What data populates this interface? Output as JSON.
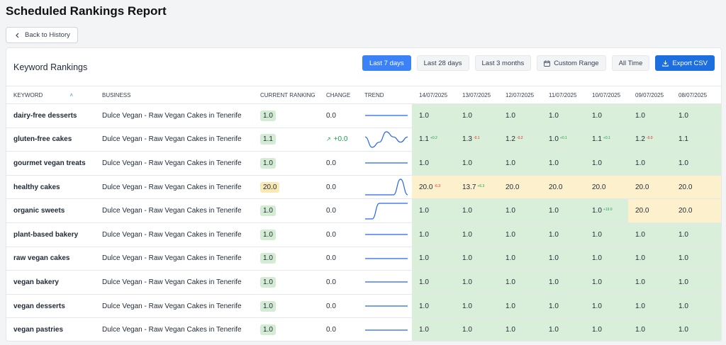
{
  "page": {
    "title": "Scheduled Rankings Report",
    "back_label": "Back to History"
  },
  "card": {
    "title": "Keyword Rankings"
  },
  "toolbar": {
    "buttons": [
      "Last 7 days",
      "Last 28 days",
      "Last 3 months",
      "Custom Range",
      "All Time"
    ],
    "active": "Last 7 days",
    "export_label": "Export CSV"
  },
  "columns": {
    "keyword": "KEYWORD",
    "business": "BUSINESS",
    "current": "CURRENT RANKING",
    "change": "CHANGE",
    "trend": "TREND",
    "dates": [
      "14/07/2025",
      "13/07/2025",
      "12/07/2025",
      "11/07/2025",
      "10/07/2025",
      "09/07/2025",
      "08/07/2025"
    ]
  },
  "colors": {
    "good": "#d9efd9",
    "warn": "#fdf1cd",
    "accent": "#3b82f6",
    "spark": "#2563eb"
  },
  "rows": [
    {
      "keyword": "dairy-free desserts",
      "business": "Dulce Vegan - Raw Vegan Cakes in Tenerife",
      "current": "1.0",
      "current_status": "good",
      "change": "0.0",
      "change_dir": "none",
      "trend": [
        1,
        1,
        1,
        1,
        1,
        1,
        1
      ],
      "cells": [
        {
          "v": "1.0",
          "s": "good"
        },
        {
          "v": "1.0",
          "s": "good"
        },
        {
          "v": "1.0",
          "s": "good"
        },
        {
          "v": "1.0",
          "s": "good"
        },
        {
          "v": "1.0",
          "s": "good"
        },
        {
          "v": "1.0",
          "s": "good"
        },
        {
          "v": "1.0",
          "s": "good"
        }
      ]
    },
    {
      "keyword": "gluten-free cakes",
      "business": "Dulce Vegan - Raw Vegan Cakes in Tenerife",
      "current": "1.1",
      "current_status": "good",
      "change": "+0.0",
      "change_dir": "up",
      "trend": [
        1.1,
        1.3,
        1.2,
        1.0,
        1.1,
        1.2,
        1.1
      ],
      "cells": [
        {
          "v": "1.1",
          "s": "good",
          "d": "+0.2",
          "dir": "up"
        },
        {
          "v": "1.3",
          "s": "good",
          "d": "-0.1",
          "dir": "down"
        },
        {
          "v": "1.2",
          "s": "good",
          "d": "-0.2",
          "dir": "down"
        },
        {
          "v": "1.0",
          "s": "good",
          "d": "+0.1",
          "dir": "up"
        },
        {
          "v": "1.1",
          "s": "good",
          "d": "+0.1",
          "dir": "up"
        },
        {
          "v": "1.2",
          "s": "good",
          "d": "-0.0",
          "dir": "down"
        },
        {
          "v": "1.1",
          "s": "good"
        }
      ]
    },
    {
      "keyword": "gourmet vegan treats",
      "business": "Dulce Vegan - Raw Vegan Cakes in Tenerife",
      "current": "1.0",
      "current_status": "good",
      "change": "0.0",
      "change_dir": "none",
      "trend": [
        1,
        1,
        1,
        1,
        1,
        1,
        1
      ],
      "cells": [
        {
          "v": "1.0",
          "s": "good"
        },
        {
          "v": "1.0",
          "s": "good"
        },
        {
          "v": "1.0",
          "s": "good"
        },
        {
          "v": "1.0",
          "s": "good"
        },
        {
          "v": "1.0",
          "s": "good"
        },
        {
          "v": "1.0",
          "s": "good"
        },
        {
          "v": "1.0",
          "s": "good"
        }
      ]
    },
    {
      "keyword": "healthy cakes",
      "business": "Dulce Vegan - Raw Vegan Cakes in Tenerife",
      "current": "20.0",
      "current_status": "warn",
      "change": "0.0",
      "change_dir": "none",
      "trend": [
        20,
        20,
        20,
        20,
        20,
        13.7,
        20
      ],
      "cells": [
        {
          "v": "20.0",
          "s": "warn",
          "d": "-6.3",
          "dir": "down"
        },
        {
          "v": "13.7",
          "s": "warn",
          "d": "+6.3",
          "dir": "up"
        },
        {
          "v": "20.0",
          "s": "warn"
        },
        {
          "v": "20.0",
          "s": "warn"
        },
        {
          "v": "20.0",
          "s": "warn"
        },
        {
          "v": "20.0",
          "s": "warn"
        },
        {
          "v": "20.0",
          "s": "warn"
        }
      ]
    },
    {
      "keyword": "organic sweets",
      "business": "Dulce Vegan - Raw Vegan Cakes in Tenerife",
      "current": "1.0",
      "current_status": "good",
      "change": "0.0",
      "change_dir": "none",
      "trend": [
        20,
        20,
        1,
        1,
        1,
        1,
        1
      ],
      "cells": [
        {
          "v": "1.0",
          "s": "good"
        },
        {
          "v": "1.0",
          "s": "good"
        },
        {
          "v": "1.0",
          "s": "good"
        },
        {
          "v": "1.0",
          "s": "good"
        },
        {
          "v": "1.0",
          "s": "good",
          "d": "+19.0",
          "dir": "up"
        },
        {
          "v": "20.0",
          "s": "warn"
        },
        {
          "v": "20.0",
          "s": "warn"
        }
      ]
    },
    {
      "keyword": "plant-based bakery",
      "business": "Dulce Vegan - Raw Vegan Cakes in Tenerife",
      "current": "1.0",
      "current_status": "good",
      "change": "0.0",
      "change_dir": "none",
      "trend": [
        1,
        1,
        1,
        1,
        1,
        1,
        1
      ],
      "cells": [
        {
          "v": "1.0",
          "s": "good"
        },
        {
          "v": "1.0",
          "s": "good"
        },
        {
          "v": "1.0",
          "s": "good"
        },
        {
          "v": "1.0",
          "s": "good"
        },
        {
          "v": "1.0",
          "s": "good"
        },
        {
          "v": "1.0",
          "s": "good"
        },
        {
          "v": "1.0",
          "s": "good"
        }
      ]
    },
    {
      "keyword": "raw vegan cakes",
      "business": "Dulce Vegan - Raw Vegan Cakes in Tenerife",
      "current": "1.0",
      "current_status": "good",
      "change": "0.0",
      "change_dir": "none",
      "trend": [
        1,
        1,
        1,
        1,
        1,
        1,
        1
      ],
      "cells": [
        {
          "v": "1.0",
          "s": "good"
        },
        {
          "v": "1.0",
          "s": "good"
        },
        {
          "v": "1.0",
          "s": "good"
        },
        {
          "v": "1.0",
          "s": "good"
        },
        {
          "v": "1.0",
          "s": "good"
        },
        {
          "v": "1.0",
          "s": "good"
        },
        {
          "v": "1.0",
          "s": "good"
        }
      ]
    },
    {
      "keyword": "vegan bakery",
      "business": "Dulce Vegan - Raw Vegan Cakes in Tenerife",
      "current": "1.0",
      "current_status": "good",
      "change": "0.0",
      "change_dir": "none",
      "trend": [
        1,
        1,
        1,
        1,
        1,
        1,
        1
      ],
      "cells": [
        {
          "v": "1.0",
          "s": "good"
        },
        {
          "v": "1.0",
          "s": "good"
        },
        {
          "v": "1.0",
          "s": "good"
        },
        {
          "v": "1.0",
          "s": "good"
        },
        {
          "v": "1.0",
          "s": "good"
        },
        {
          "v": "1.0",
          "s": "good"
        },
        {
          "v": "1.0",
          "s": "good"
        }
      ]
    },
    {
      "keyword": "vegan desserts",
      "business": "Dulce Vegan - Raw Vegan Cakes in Tenerife",
      "current": "1.0",
      "current_status": "good",
      "change": "0.0",
      "change_dir": "none",
      "trend": [
        1,
        1,
        1,
        1,
        1,
        1,
        1
      ],
      "cells": [
        {
          "v": "1.0",
          "s": "good"
        },
        {
          "v": "1.0",
          "s": "good"
        },
        {
          "v": "1.0",
          "s": "good"
        },
        {
          "v": "1.0",
          "s": "good"
        },
        {
          "v": "1.0",
          "s": "good"
        },
        {
          "v": "1.0",
          "s": "good"
        },
        {
          "v": "1.0",
          "s": "good"
        }
      ]
    },
    {
      "keyword": "vegan pastries",
      "business": "Dulce Vegan - Raw Vegan Cakes in Tenerife",
      "current": "1.0",
      "current_status": "good",
      "change": "0.0",
      "change_dir": "none",
      "trend": [
        1,
        1,
        1,
        1,
        1,
        1,
        1
      ],
      "cells": [
        {
          "v": "1.0",
          "s": "good"
        },
        {
          "v": "1.0",
          "s": "good"
        },
        {
          "v": "1.0",
          "s": "good"
        },
        {
          "v": "1.0",
          "s": "good"
        },
        {
          "v": "1.0",
          "s": "good"
        },
        {
          "v": "1.0",
          "s": "good"
        },
        {
          "v": "1.0",
          "s": "good"
        }
      ]
    }
  ]
}
